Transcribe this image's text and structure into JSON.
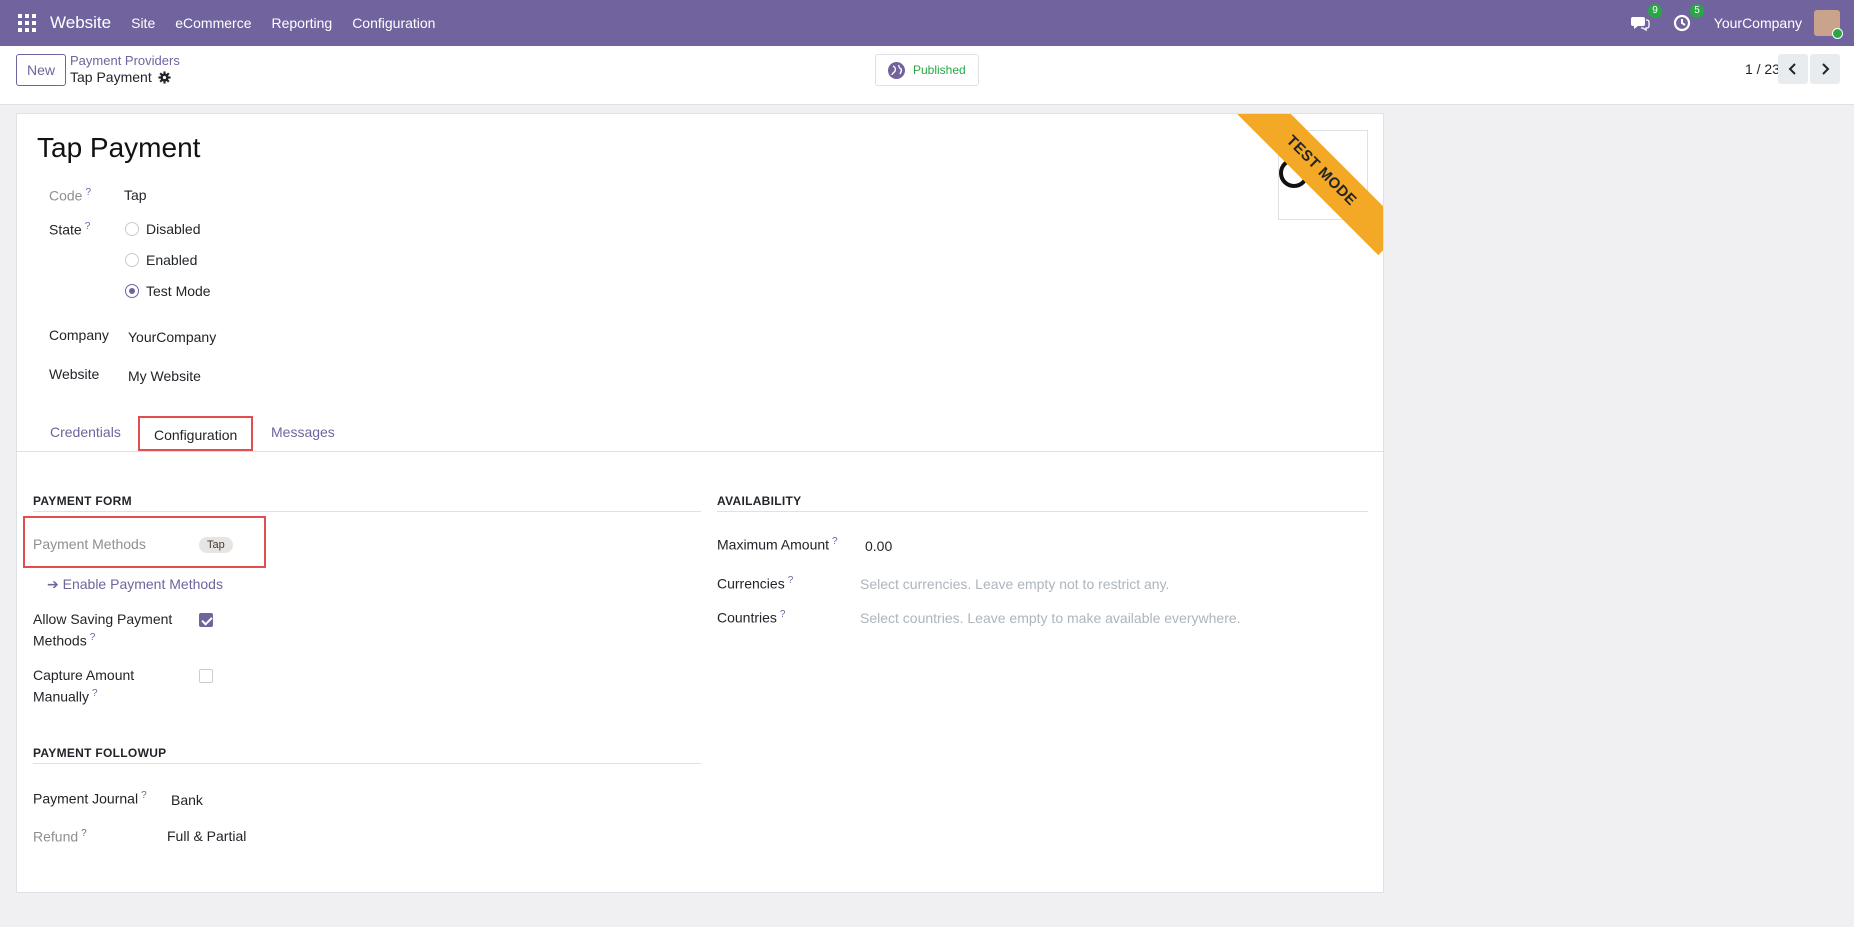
{
  "navbar": {
    "app_name": "Website",
    "menu": [
      "Site",
      "eCommerce",
      "Reporting",
      "Configuration"
    ],
    "messages_count": "9",
    "activities_count": "5",
    "company": "YourCompany"
  },
  "control": {
    "new_label": "New",
    "breadcrumb": "Payment Providers",
    "record": "Tap Payment",
    "published_label": "Published",
    "pager": "1 / 23"
  },
  "form": {
    "title": "Tap Payment",
    "ribbon": "TEST MODE",
    "code_label": "Code",
    "code_value": "Tap",
    "state_label": "State",
    "state_options": [
      "Disabled",
      "Enabled",
      "Test Mode"
    ],
    "state_selected": "Test Mode",
    "company_label": "Company",
    "company_value": "YourCompany",
    "website_label": "Website",
    "website_value": "My Website",
    "help_mark": "?"
  },
  "tabs": [
    "Credentials",
    "Configuration",
    "Messages"
  ],
  "active_tab": "Configuration",
  "payment_form": {
    "title": "PAYMENT FORM",
    "methods_label": "Payment Methods",
    "methods_tag": "Tap",
    "enable_link": "Enable Payment Methods",
    "allow_saving_label_1": "Allow Saving Payment",
    "allow_saving_label_2": "Methods",
    "allow_saving_checked": true,
    "capture_label_1": "Capture Amount",
    "capture_label_2": "Manually",
    "capture_checked": false
  },
  "availability": {
    "title": "AVAILABILITY",
    "max_amount_label": "Maximum Amount",
    "max_amount_value": "0.00",
    "currencies_label": "Currencies",
    "currencies_placeholder": "Select currencies. Leave empty not to restrict any.",
    "countries_label": "Countries",
    "countries_placeholder": "Select countries. Leave empty to make available everywhere."
  },
  "followup": {
    "title": "PAYMENT FOLLOWUP",
    "journal_label": "Payment Journal",
    "journal_value": "Bank",
    "refund_label": "Refund",
    "refund_value": "Full & Partial"
  },
  "colors": {
    "brand": "#71639e",
    "ribbon": "#f3a826",
    "highlight": "#e34d4d",
    "success": "#28a745"
  }
}
